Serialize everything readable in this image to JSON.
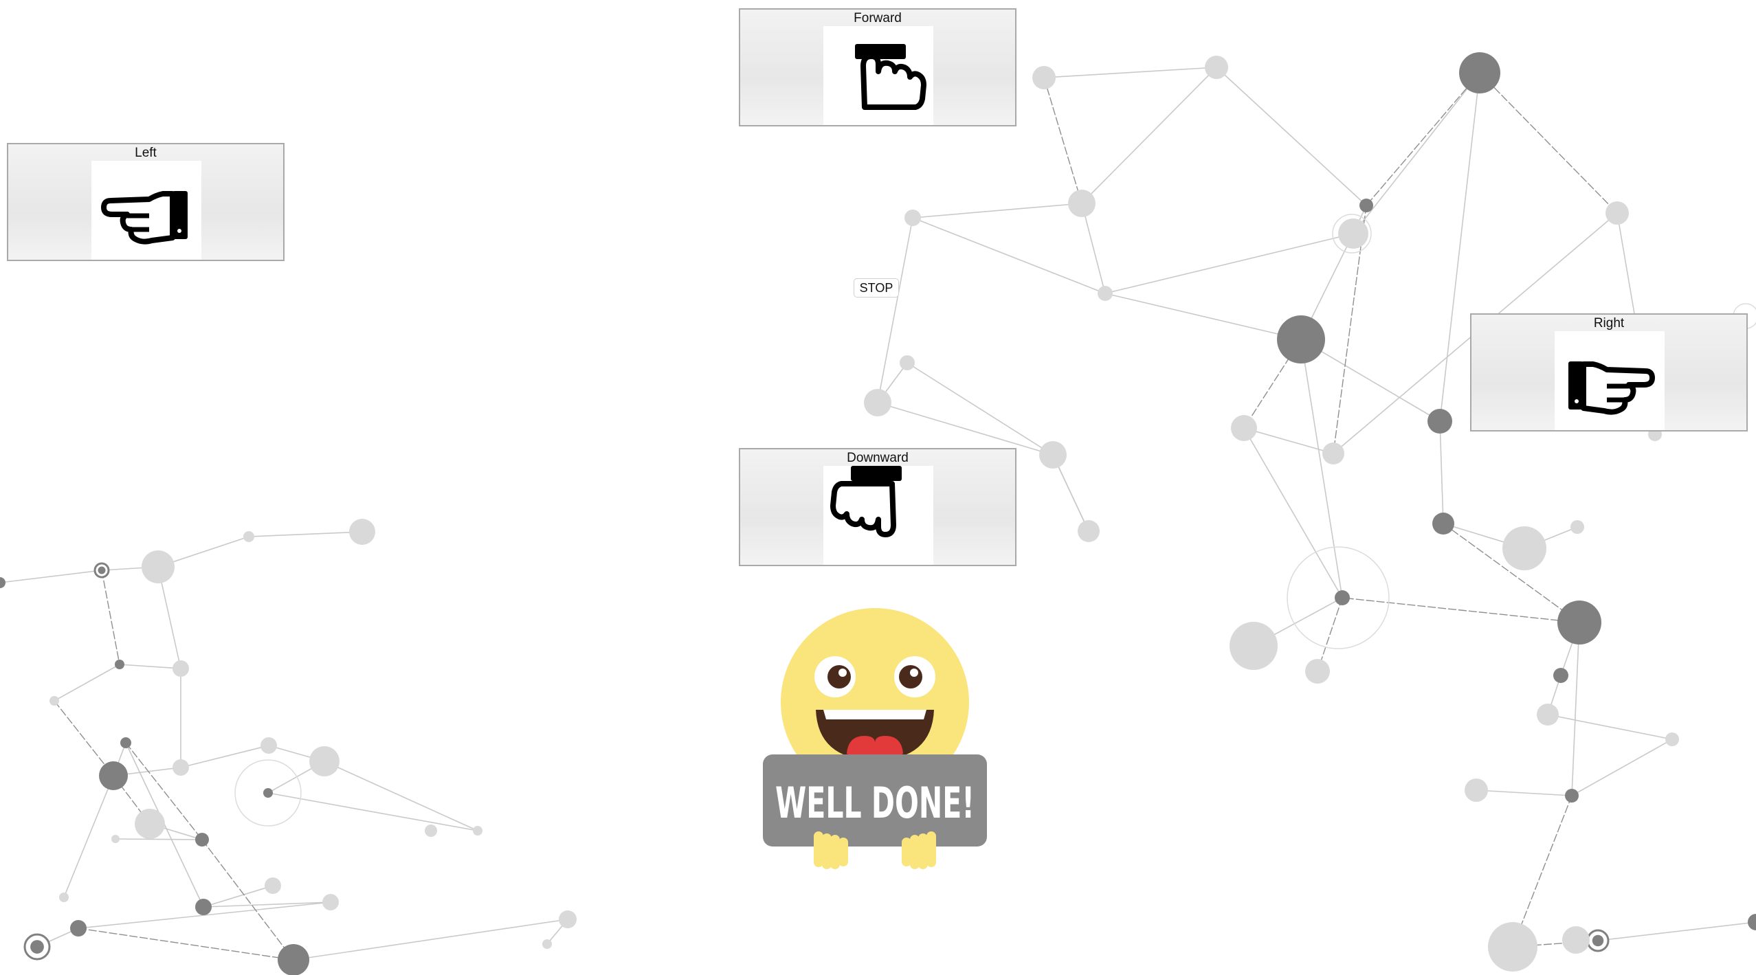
{
  "controls": {
    "forward": {
      "label": "Forward",
      "icon": "hand-pointing-up-icon"
    },
    "left": {
      "label": "Left",
      "icon": "hand-pointing-left-icon"
    },
    "right": {
      "label": "Right",
      "icon": "hand-pointing-right-icon"
    },
    "downward": {
      "label": "Downward",
      "icon": "hand-pointing-down-icon"
    },
    "stop": {
      "label": "STOP"
    }
  },
  "celebration": {
    "banner_text": "WELL DONE!",
    "icon": "smiley-well-done-icon"
  },
  "colors": {
    "background": "#ffffff",
    "network_light": "#d9d9d9",
    "network_dark": "#808080",
    "smiley_face": "#f9e57c",
    "banner": "#8a8a8a",
    "mouth": "#4a2a1a",
    "tongue": "#e23a3a"
  }
}
